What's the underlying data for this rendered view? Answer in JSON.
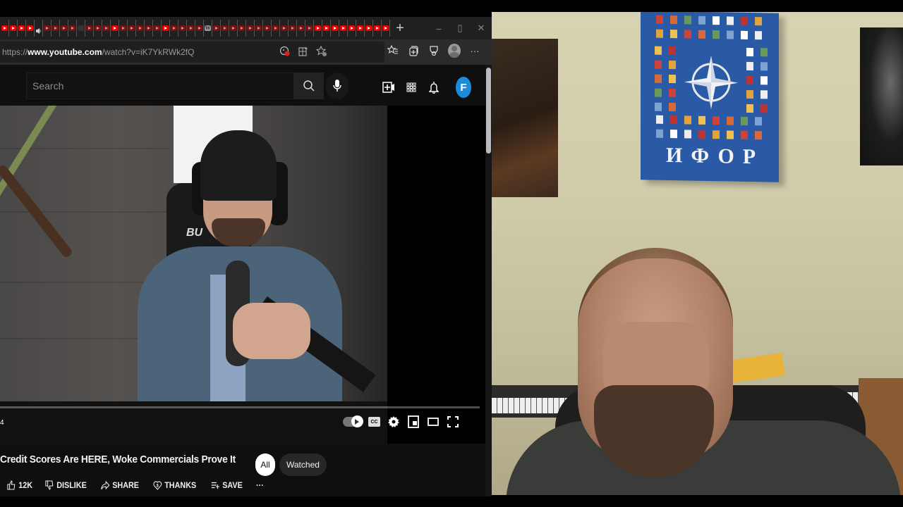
{
  "browser": {
    "tabs": [
      {
        "kind": "youtube"
      },
      {
        "kind": "youtube"
      },
      {
        "kind": "youtube"
      },
      {
        "kind": "youtube"
      },
      {
        "kind": "audio"
      },
      {
        "kind": "youtube-dim"
      },
      {
        "kind": "youtube-dim"
      },
      {
        "kind": "youtube-dim"
      },
      {
        "kind": "youtube-dim"
      },
      {
        "kind": "blank"
      },
      {
        "kind": "youtube-dim"
      },
      {
        "kind": "youtube-dim"
      },
      {
        "kind": "youtube-dim"
      },
      {
        "kind": "youtube"
      },
      {
        "kind": "youtube-dim"
      },
      {
        "kind": "youtube-dim"
      },
      {
        "kind": "youtube-dim"
      },
      {
        "kind": "youtube-dim"
      },
      {
        "kind": "youtube-dim"
      },
      {
        "kind": "youtube"
      },
      {
        "kind": "youtube-dim"
      },
      {
        "kind": "youtube-dim"
      },
      {
        "kind": "youtube-dim"
      },
      {
        "kind": "youtube-dim"
      },
      {
        "kind": "wiki"
      },
      {
        "kind": "youtube-dim"
      },
      {
        "kind": "youtube-dim"
      },
      {
        "kind": "youtube-dim"
      },
      {
        "kind": "youtube-dim"
      },
      {
        "kind": "youtube-dim"
      },
      {
        "kind": "youtube-dim"
      },
      {
        "kind": "youtube-dim"
      },
      {
        "kind": "youtube-dim"
      },
      {
        "kind": "youtube-dim"
      },
      {
        "kind": "youtube-dim"
      },
      {
        "kind": "youtube-dim"
      },
      {
        "kind": "youtube-dim"
      },
      {
        "kind": "youtube"
      },
      {
        "kind": "youtube"
      },
      {
        "kind": "youtube"
      },
      {
        "kind": "youtube"
      },
      {
        "kind": "youtube"
      },
      {
        "kind": "youtube"
      },
      {
        "kind": "youtube"
      },
      {
        "kind": "youtube"
      },
      {
        "kind": "youtube"
      }
    ],
    "new_tab_label": "+",
    "window_controls": {
      "minimize": "–",
      "restore": "▯",
      "close": "✕"
    },
    "address": {
      "scheme": "https://",
      "host": "www.youtube.com",
      "path": "/watch?v=iK7YkRWk2fQ"
    },
    "toolbar_icons": [
      "tracking-prevention-icon",
      "app-available-icon",
      "add-favorite-icon",
      "favorites-icon",
      "collections-icon",
      "extensions-icon",
      "profile-icon",
      "more-icon"
    ],
    "more_label": "···"
  },
  "youtube": {
    "search": {
      "placeholder": "Search",
      "value": ""
    },
    "header_icons": [
      "create-icon",
      "apps-icon",
      "notifications-icon"
    ],
    "avatar_letter": "F",
    "avatar_color": "#1a8cd8",
    "player": {
      "progress_fraction": 0.0,
      "time_fragment": "4",
      "controls": [
        "autoplay-toggle",
        "captions",
        "settings",
        "miniplayer",
        "theater-mode",
        "fullscreen"
      ],
      "cc_label": "CC"
    },
    "video": {
      "title": "Credit Scores Are HERE, Woke Commercials Prove It",
      "chair_brand_fragment": "BU"
    },
    "chips": [
      {
        "label": "All",
        "active": true
      },
      {
        "label": "Watched",
        "active": false
      }
    ],
    "actions": [
      {
        "icon": "thumbs-up-icon",
        "label": "12K"
      },
      {
        "icon": "thumbs-down-icon",
        "label": "DISLIKE"
      },
      {
        "icon": "share-icon",
        "label": "SHARE"
      },
      {
        "icon": "thanks-icon",
        "label": "THANKS"
      },
      {
        "icon": "save-icon",
        "label": "SAVE"
      },
      {
        "icon": "more-icon",
        "label": "···"
      }
    ]
  },
  "webcam": {
    "flag_text": "ИФОР"
  }
}
